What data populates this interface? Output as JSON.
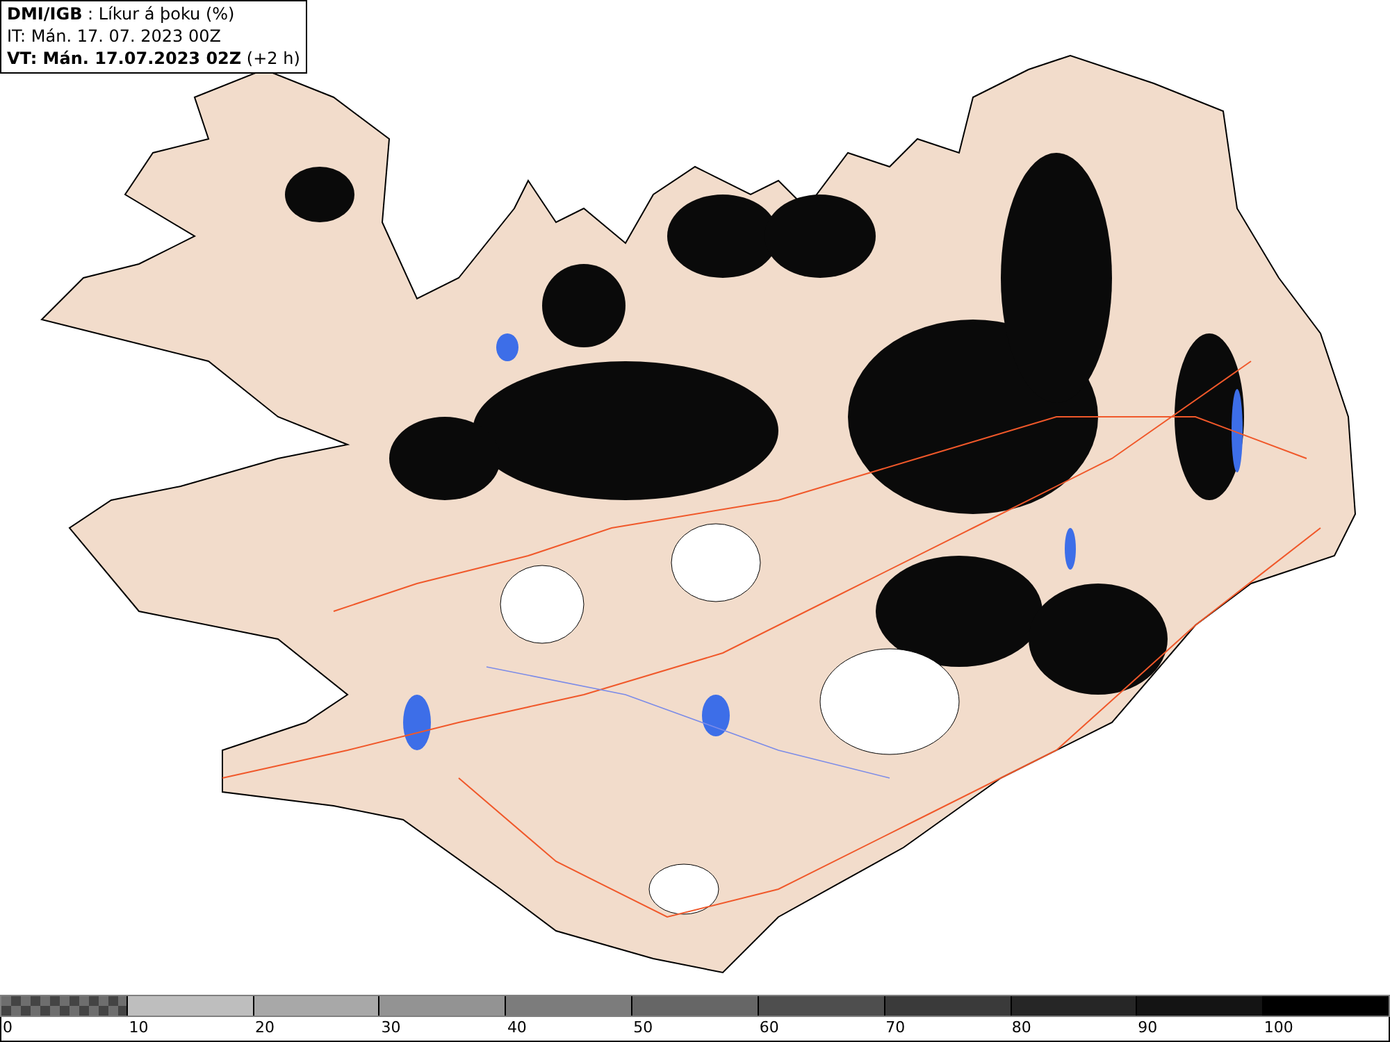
{
  "header": {
    "lines": [
      "**DMI/IGB** : Líkur á þoku (%)",
      "IT: Mán. 17. 07. 2023 00Z",
      "**VT: Mán. 17.07.2023 02Z** (+2 h)"
    ]
  },
  "legend": {
    "swatches": [
      {
        "kind": "checker",
        "color": "#6e6e6e"
      },
      {
        "kind": "solid",
        "color": "#bebebe"
      },
      {
        "kind": "solid",
        "color": "#a8a8a8"
      },
      {
        "kind": "solid",
        "color": "#939393"
      },
      {
        "kind": "solid",
        "color": "#7c7c7c"
      },
      {
        "kind": "solid",
        "color": "#666666"
      },
      {
        "kind": "solid",
        "color": "#4e4e4e"
      },
      {
        "kind": "solid",
        "color": "#3a3a3a"
      },
      {
        "kind": "solid",
        "color": "#262626"
      },
      {
        "kind": "solid",
        "color": "#141414"
      },
      {
        "kind": "solid",
        "color": "#000000"
      }
    ],
    "labels": [
      "0",
      "10",
      "20",
      "30",
      "40",
      "50",
      "60",
      "70",
      "80",
      "90",
      "100"
    ]
  }
}
